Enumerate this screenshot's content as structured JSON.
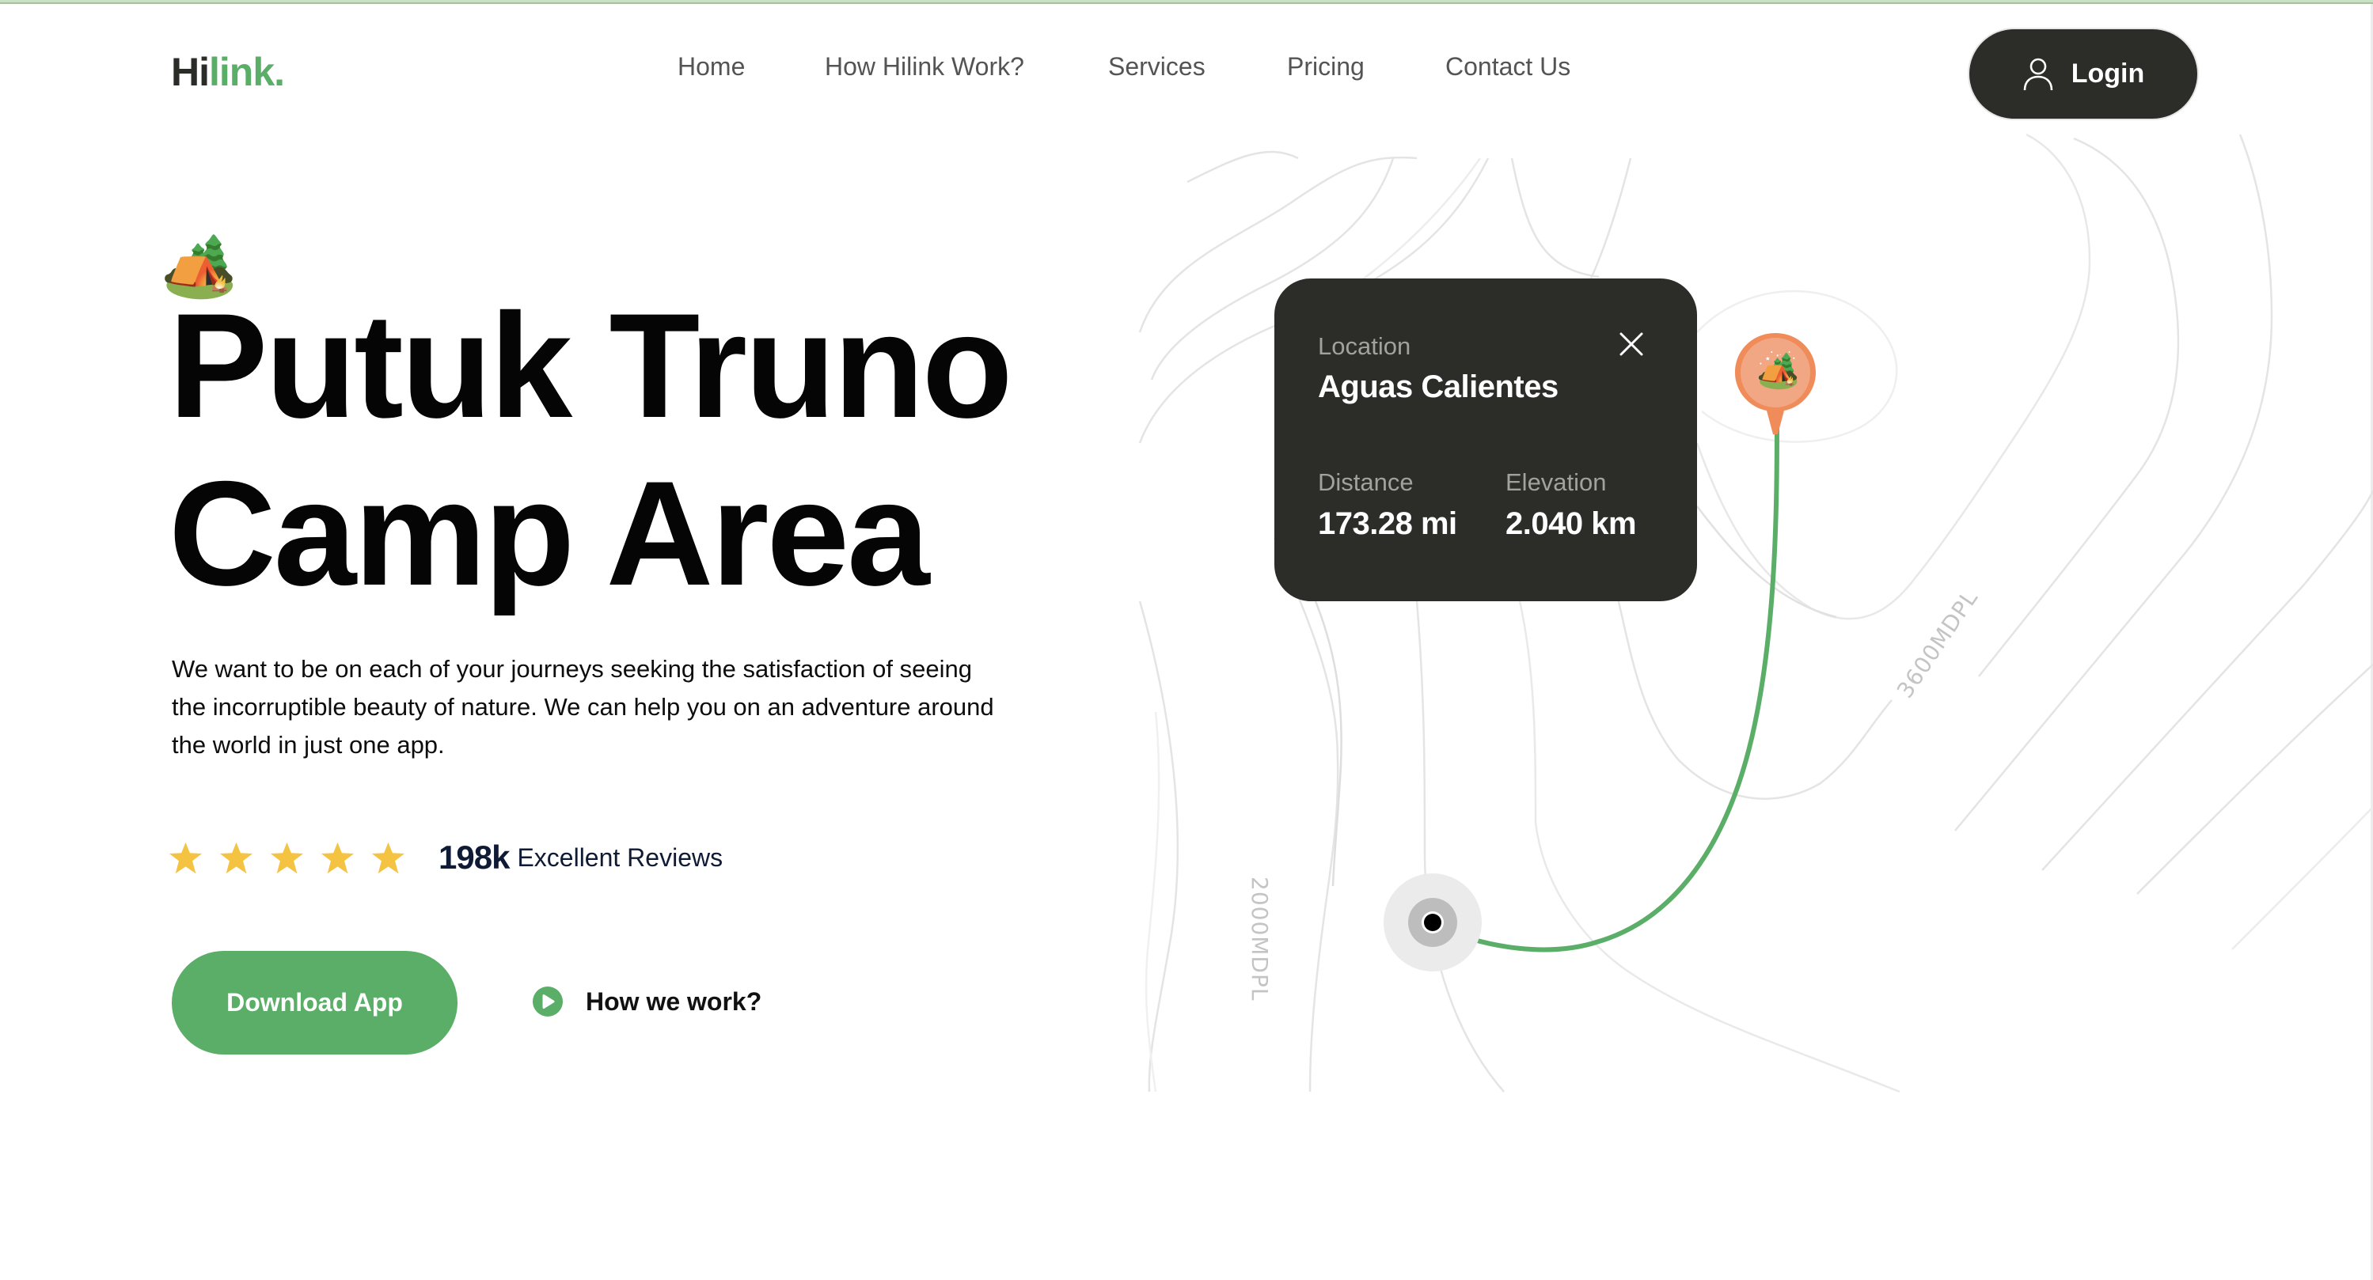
{
  "colors": {
    "brand_green": "#5aae67",
    "dark": "#2c2d29",
    "star": "#f5c342",
    "pin_orange": "#f08c5a",
    "contour": "#e2e2e2"
  },
  "header": {
    "logo": {
      "part1": "Hi",
      "part2": "link."
    },
    "nav": [
      {
        "label": "Home"
      },
      {
        "label": "How Hilink Work?"
      },
      {
        "label": "Services"
      },
      {
        "label": "Pricing"
      },
      {
        "label": "Contact Us"
      }
    ],
    "login": {
      "label": "Login",
      "icon": "user-icon"
    }
  },
  "hero": {
    "emoji": "🏕️",
    "title_line1": "Putuk Truno",
    "title_line2": "Camp Area",
    "description": "We want to be on each of your journeys seeking the satisfaction of seeing the incorruptible beauty of nature. We can help you on an adventure around the world in just one app.",
    "rating": {
      "stars": 5,
      "count": "198k",
      "label": "Excellent Reviews"
    },
    "primary_button": "Download App",
    "secondary_link": {
      "label": "How we work?",
      "icon": "play-icon"
    }
  },
  "map": {
    "contour_labels": [
      "2000MDPL",
      "3600MDPL"
    ],
    "card": {
      "location_label": "Location",
      "location_value": "Aguas Calientes",
      "distance_label": "Distance",
      "distance_value": "173.28 mi",
      "elevation_label": "Elevation",
      "elevation_value": "2.040 km",
      "close_icon": "close-icon"
    },
    "destination_pin": {
      "emoji": "🏕️",
      "icon": "camp-pin-icon"
    },
    "origin_marker": {
      "icon": "current-location-icon"
    }
  }
}
